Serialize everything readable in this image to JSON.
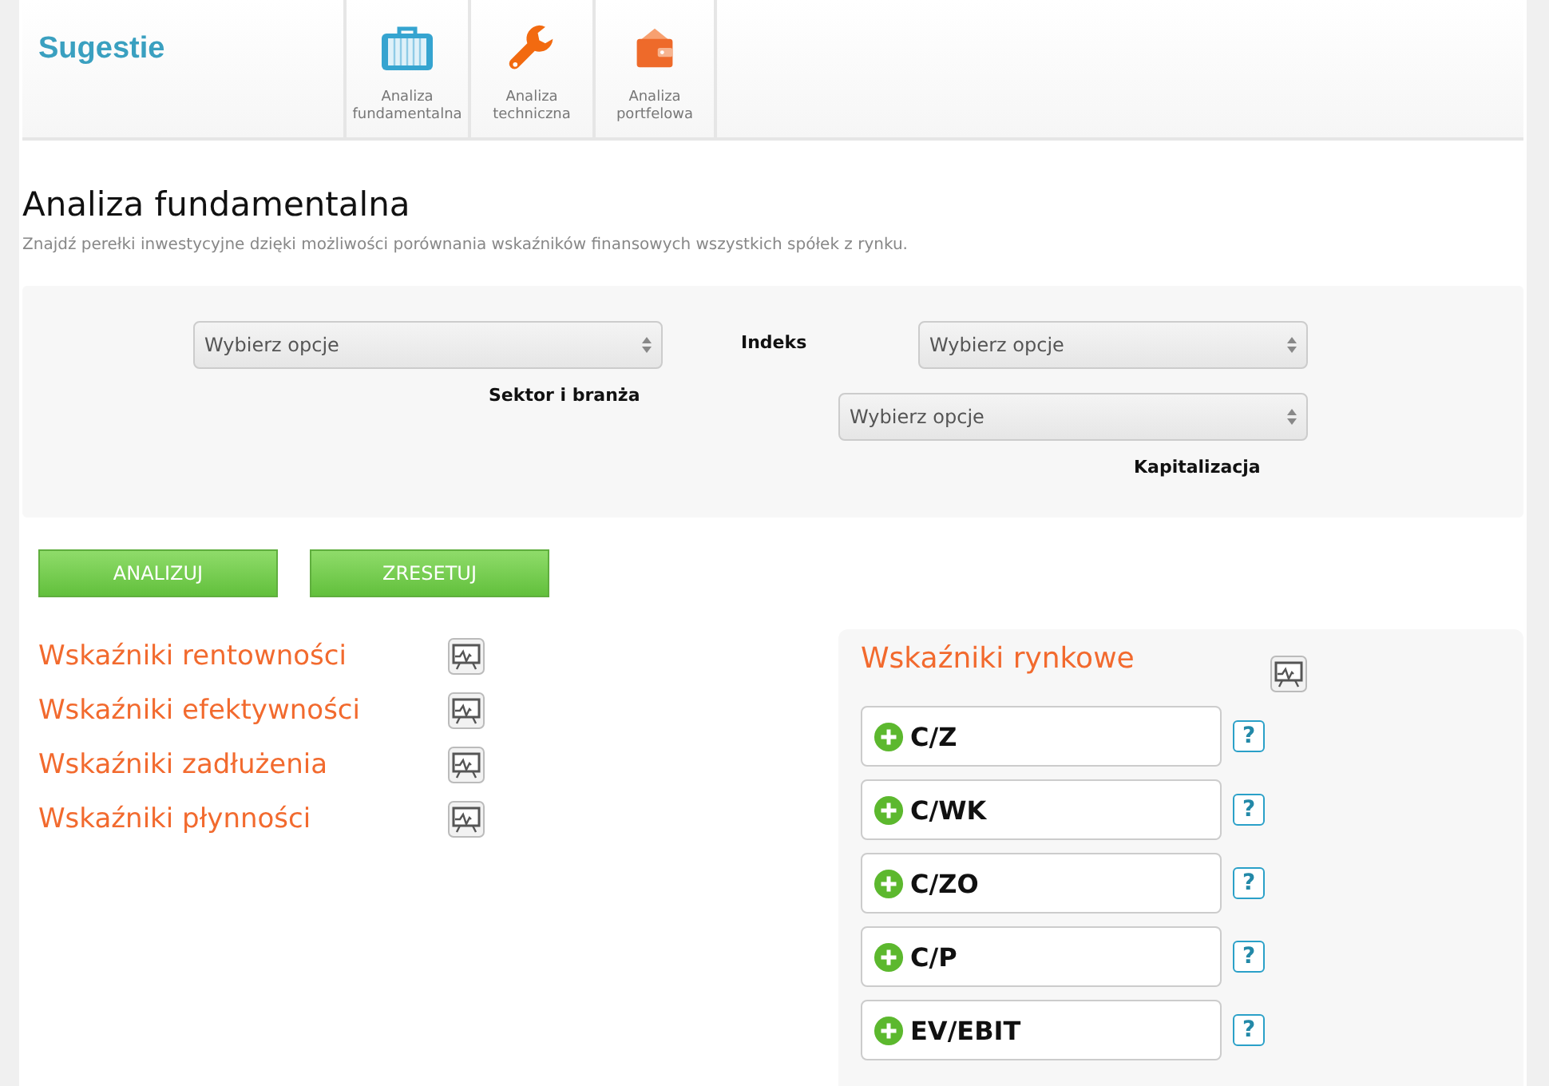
{
  "header": {
    "title": "Sugestie",
    "tabs": [
      {
        "label": "Analiza fundamentalna"
      },
      {
        "label": "Analiza techniczna"
      },
      {
        "label": "Analiza portfelowa"
      }
    ]
  },
  "page": {
    "heading": "Analiza fundamentalna",
    "subtitle": "Znajdź perełki inwestycyjne dzięki możliwości porównania wskaźników finansowych wszystkich spółek z rynku."
  },
  "filters": {
    "sector": {
      "value": "Wybierz opcje",
      "label": "Sektor i branża"
    },
    "index": {
      "label": "Indeks",
      "value": "Wybierz opcje"
    },
    "cap": {
      "value": "Wybierz opcje",
      "label": "Kapitalizacja"
    }
  },
  "buttons": [
    "ANALIZUJ",
    "ZRESETUJ"
  ],
  "groups": [
    {
      "label": "Wskaźniki rentowności"
    },
    {
      "label": "Wskaźniki efektywności"
    },
    {
      "label": "Wskaźniki zadłużenia"
    },
    {
      "label": "Wskaźniki płynności"
    }
  ],
  "market": {
    "title": "Wskaźniki rynkowe",
    "items": [
      {
        "label": "C/Z",
        "help": "?"
      },
      {
        "label": "C/WK",
        "help": "?"
      },
      {
        "label": "C/ZO",
        "help": "?"
      },
      {
        "label": "C/P",
        "help": "?"
      },
      {
        "label": "EV/EBIT",
        "help": "?"
      }
    ]
  }
}
